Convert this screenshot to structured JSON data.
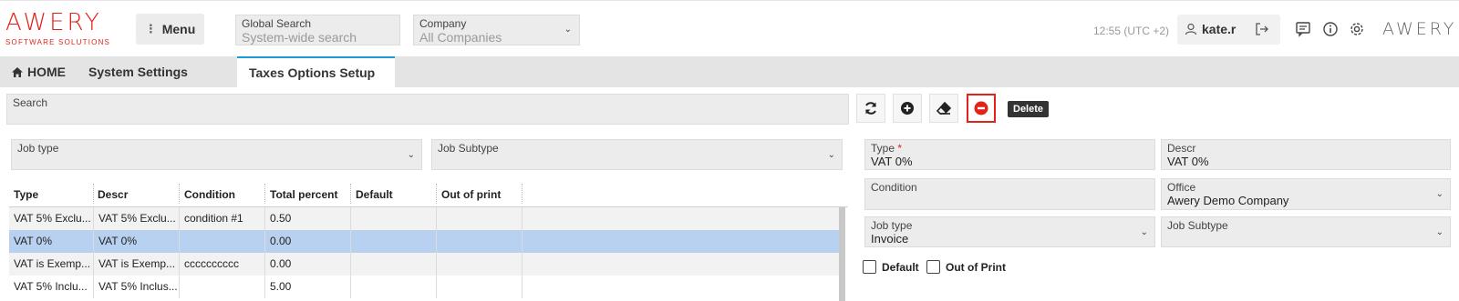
{
  "header": {
    "logo_text": "AWERY",
    "logo_subtext": "SOFTWARE SOLUTIONS",
    "menu_label": "Menu",
    "global_search": {
      "label": "Global Search",
      "placeholder": "System-wide search"
    },
    "company": {
      "label": "Company",
      "value": "All Companies"
    },
    "time": "12:55 (UTC +2)",
    "username": "kate.r",
    "right_logo": "AWERY"
  },
  "tabs": [
    {
      "label": "HOME",
      "icon": "home-icon"
    },
    {
      "label": "System Settings"
    },
    {
      "label": "Taxes Options Setup",
      "active": true
    }
  ],
  "search": {
    "label": "Search"
  },
  "filters": {
    "job_type": {
      "label": "Job type",
      "value": ""
    },
    "job_subtype": {
      "label": "Job Subtype",
      "value": ""
    }
  },
  "grid": {
    "columns": [
      "Type",
      "Descr",
      "Condition",
      "Total percent",
      "Default",
      "Out of print"
    ],
    "rows": [
      {
        "type": "VAT 5% Exclu...",
        "descr": "VAT 5% Exclu...",
        "condition": "condition #1",
        "total": "0.50",
        "default": "",
        "out_of_print": ""
      },
      {
        "type": "VAT 0%",
        "descr": "VAT 0%",
        "condition": "",
        "total": "0.00",
        "default": "",
        "out_of_print": "",
        "selected": true
      },
      {
        "type": "VAT is Exemp...",
        "descr": "VAT is Exemp...",
        "condition": "cccccccccc",
        "total": "0.00",
        "default": "",
        "out_of_print": ""
      },
      {
        "type": "VAT 5% Inclu...",
        "descr": "VAT 5% Inclus...",
        "condition": "",
        "total": "5.00",
        "default": "",
        "out_of_print": ""
      }
    ]
  },
  "toolbar": {
    "refresh_icon": "refresh-icon",
    "add_icon": "plus-circle-icon",
    "clear_icon": "eraser-icon",
    "delete_icon": "minus-circle-icon",
    "tooltip": "Delete"
  },
  "form": {
    "type": {
      "label": "Type",
      "required_mark": "*",
      "value": "VAT 0%"
    },
    "descr": {
      "label": "Descr",
      "value": "VAT 0%"
    },
    "condition": {
      "label": "Condition",
      "value": ""
    },
    "office": {
      "label": "Office",
      "value": "Awery Demo Company"
    },
    "job_type": {
      "label": "Job type",
      "value": "Invoice"
    },
    "job_subtype": {
      "label": "Job Subtype",
      "value": ""
    },
    "default_label": "Default",
    "out_of_print_label": "Out of Print"
  },
  "colors": {
    "brand": "#e2231a",
    "accent": "#1b9bd1",
    "selected_row": "#b9d1f0"
  }
}
